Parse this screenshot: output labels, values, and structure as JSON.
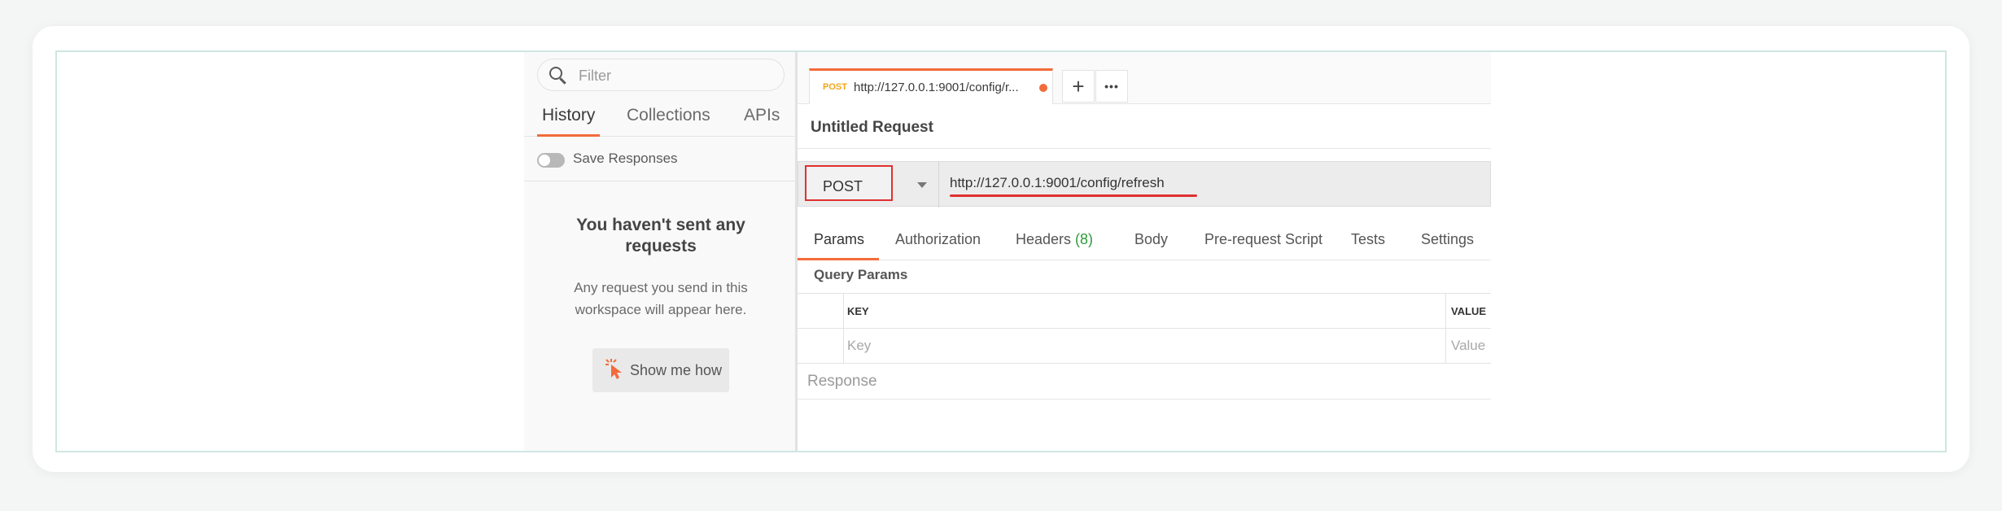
{
  "sidebar": {
    "filter_placeholder": "Filter",
    "tabs": [
      {
        "label": "History"
      },
      {
        "label": "Collections"
      },
      {
        "label": "APIs"
      }
    ],
    "save_responses": "Save Responses",
    "empty_title": "You haven't sent any requests",
    "empty_desc": "Any request you send in this workspace will appear here.",
    "show_me_how": "Show me how"
  },
  "request_tab": {
    "method": "POST",
    "url": "http://127.0.0.1:9001/config/r...",
    "add": "+",
    "more": "•••"
  },
  "request": {
    "title": "Untitled Request",
    "method": "POST",
    "url": "http://127.0.0.1:9001/config/refresh"
  },
  "param_tabs": [
    {
      "label": "Params"
    },
    {
      "label": "Authorization"
    },
    {
      "label": "Headers ",
      "count": "(8)"
    },
    {
      "label": "Body"
    },
    {
      "label": "Pre-request Script"
    },
    {
      "label": "Tests"
    },
    {
      "label": "Settings"
    }
  ],
  "query_params": {
    "title": "Query Params",
    "key_header": "KEY",
    "value_header": "VALUE",
    "key_placeholder": "Key",
    "value_placeholder": "Value"
  },
  "response_label": "Response",
  "colors": {
    "accent": "#f26b3a",
    "method_tab": "#f0a51c",
    "highlight": "#e03030",
    "count": "#2e9a3a"
  }
}
